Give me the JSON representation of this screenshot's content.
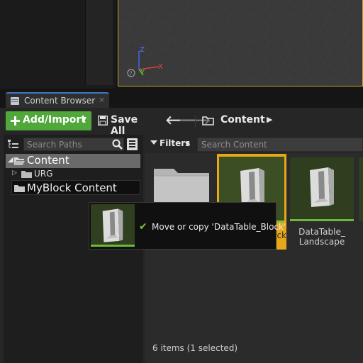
{
  "tab": {
    "label": "Content Browser",
    "close_glyph": "×"
  },
  "toolbar": {
    "add_import_label": "Add/Import",
    "save_all_label": "Save All",
    "path_root": "Content"
  },
  "sources": {
    "search_placeholder": "Search Paths",
    "tree": [
      {
        "label": "Content",
        "expanded": true,
        "selected": true
      },
      {
        "label": "URG",
        "expanded": false
      },
      {
        "label": "MyBlock Content",
        "highlighted": true
      }
    ]
  },
  "assets": {
    "filters_label": "Filters",
    "search_placeholder": "Search Content",
    "items": [
      {
        "type": "folder",
        "label": ""
      },
      {
        "type": "datatable",
        "label": "ck",
        "selected": true
      },
      {
        "type": "datatable",
        "label": "DataTable_\nLandscape"
      }
    ],
    "status": "6 items (1 selected)"
  },
  "drag_tooltip": {
    "message": "Move or copy 'DataTable_Block'"
  },
  "gizmo": {
    "x_label": "X",
    "y_label": "Y",
    "z_label": "Z"
  },
  "colors": {
    "accent_green": "#50a83a",
    "selection_gold": "#e6a817",
    "tab_blue": "#3c78c4"
  }
}
